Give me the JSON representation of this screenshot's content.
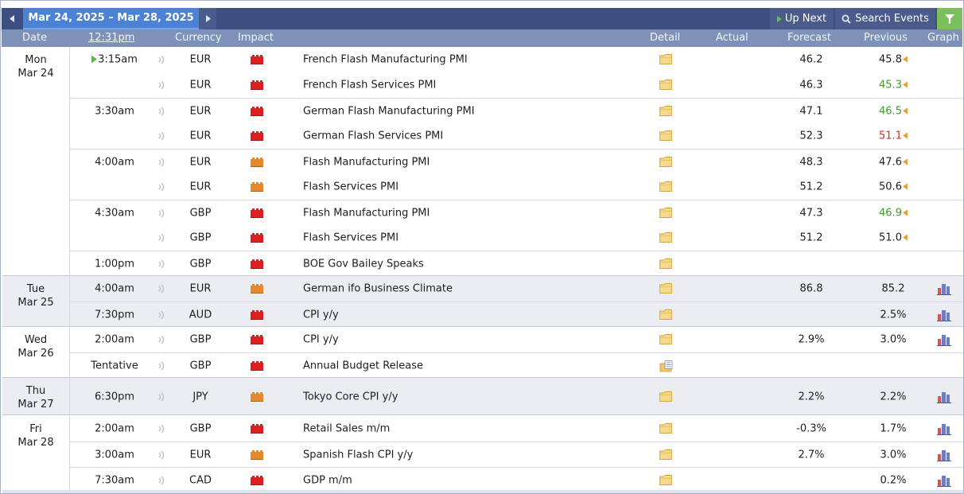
{
  "toolbar": {
    "date_range": "Mar 24, 2025 – Mar 28, 2025",
    "up_next_label": "Up Next",
    "search_label": "Search Events"
  },
  "columns": {
    "date": "Date",
    "time": "12:31pm",
    "currency": "Currency",
    "impact": "Impact",
    "detail": "Detail",
    "actual": "Actual",
    "forecast": "Forecast",
    "previous": "Previous",
    "graph": "Graph"
  },
  "colors": {
    "impact_high": "#d92020",
    "impact_medium": "#e5892e",
    "previous_better": "#3f9a2a",
    "previous_worse": "#c53030",
    "revised_marker": "#e0a13a",
    "accent": "#4b82d6"
  },
  "icons": {
    "sound": "speaker-icon",
    "impact": "folder-impact-icon",
    "detail": "folder-detail-icon",
    "graph": "bar-graph-icon",
    "filter": "funnel-icon",
    "search": "magnifier-icon"
  },
  "days": [
    {
      "weekday": "Mon",
      "date": "Mar 24",
      "events": [
        {
          "time": "3:15am",
          "next": true,
          "currency": "EUR",
          "impact": "high",
          "name": "French Flash Manufacturing PMI",
          "forecast": "46.2",
          "previous": "45.8",
          "previous_state": "",
          "revised": true,
          "graph": false,
          "detail": "folder"
        },
        {
          "time": "",
          "currency": "EUR",
          "impact": "high",
          "name": "French Flash Services PMI",
          "forecast": "46.3",
          "previous": "45.3",
          "previous_state": "better",
          "revised": true,
          "graph": false,
          "detail": "folder"
        },
        {
          "time": "3:30am",
          "currency": "EUR",
          "impact": "high",
          "name": "German Flash Manufacturing PMI",
          "forecast": "47.1",
          "previous": "46.5",
          "previous_state": "better",
          "revised": true,
          "graph": false,
          "detail": "folder"
        },
        {
          "time": "",
          "currency": "EUR",
          "impact": "high",
          "name": "German Flash Services PMI",
          "forecast": "52.3",
          "previous": "51.1",
          "previous_state": "worse",
          "revised": true,
          "graph": false,
          "detail": "folder"
        },
        {
          "time": "4:00am",
          "currency": "EUR",
          "impact": "medium",
          "name": "Flash Manufacturing PMI",
          "forecast": "48.3",
          "previous": "47.6",
          "previous_state": "",
          "revised": true,
          "graph": false,
          "detail": "folder"
        },
        {
          "time": "",
          "currency": "EUR",
          "impact": "medium",
          "name": "Flash Services PMI",
          "forecast": "51.2",
          "previous": "50.6",
          "previous_state": "",
          "revised": true,
          "graph": false,
          "detail": "folder"
        },
        {
          "time": "4:30am",
          "currency": "GBP",
          "impact": "high",
          "name": "Flash Manufacturing PMI",
          "forecast": "47.3",
          "previous": "46.9",
          "previous_state": "better",
          "revised": true,
          "graph": false,
          "detail": "folder"
        },
        {
          "time": "",
          "currency": "GBP",
          "impact": "high",
          "name": "Flash Services PMI",
          "forecast": "51.2",
          "previous": "51.0",
          "previous_state": "",
          "revised": true,
          "graph": false,
          "detail": "folder"
        },
        {
          "time": "1:00pm",
          "currency": "GBP",
          "impact": "high",
          "name": "BOE Gov Bailey Speaks",
          "forecast": "",
          "previous": "",
          "previous_state": "",
          "revised": false,
          "graph": false,
          "detail": "folder"
        }
      ]
    },
    {
      "weekday": "Tue",
      "date": "Mar 25",
      "events": [
        {
          "time": "4:00am",
          "currency": "EUR",
          "impact": "medium",
          "name": "German ifo Business Climate",
          "forecast": "86.8",
          "previous": "85.2",
          "previous_state": "",
          "revised": false,
          "graph": true,
          "detail": "folder"
        },
        {
          "time": "7:30pm",
          "currency": "AUD",
          "impact": "high",
          "name": "CPI y/y",
          "forecast": "",
          "previous": "2.5%",
          "previous_state": "",
          "revised": false,
          "graph": true,
          "detail": "folder"
        }
      ]
    },
    {
      "weekday": "Wed",
      "date": "Mar 26",
      "events": [
        {
          "time": "2:00am",
          "currency": "GBP",
          "impact": "high",
          "name": "CPI y/y",
          "forecast": "2.9%",
          "previous": "3.0%",
          "previous_state": "",
          "revised": false,
          "graph": true,
          "detail": "folder"
        },
        {
          "time": "Tentative",
          "currency": "GBP",
          "impact": "high",
          "name": "Annual Budget Release",
          "forecast": "",
          "previous": "",
          "previous_state": "",
          "revised": false,
          "graph": false,
          "detail": "folder-doc"
        }
      ]
    },
    {
      "weekday": "Thu",
      "date": "Mar 27",
      "events": [
        {
          "time": "6:30pm",
          "currency": "JPY",
          "impact": "medium",
          "name": "Tokyo Core CPI y/y",
          "forecast": "2.2%",
          "previous": "2.2%",
          "previous_state": "",
          "revised": false,
          "graph": true,
          "detail": "folder"
        }
      ]
    },
    {
      "weekday": "Fri",
      "date": "Mar 28",
      "events": [
        {
          "time": "2:00am",
          "currency": "GBP",
          "impact": "high",
          "name": "Retail Sales m/m",
          "forecast": "-0.3%",
          "previous": "1.7%",
          "previous_state": "",
          "revised": false,
          "graph": true,
          "detail": "folder"
        },
        {
          "time": "3:00am",
          "currency": "EUR",
          "impact": "medium",
          "name": "Spanish Flash CPI y/y",
          "forecast": "2.7%",
          "previous": "3.0%",
          "previous_state": "",
          "revised": false,
          "graph": true,
          "detail": "folder"
        },
        {
          "time": "7:30am",
          "currency": "CAD",
          "impact": "high",
          "name": "GDP m/m",
          "forecast": "",
          "previous": "0.2%",
          "previous_state": "",
          "revised": false,
          "graph": true,
          "detail": "folder"
        }
      ]
    }
  ]
}
